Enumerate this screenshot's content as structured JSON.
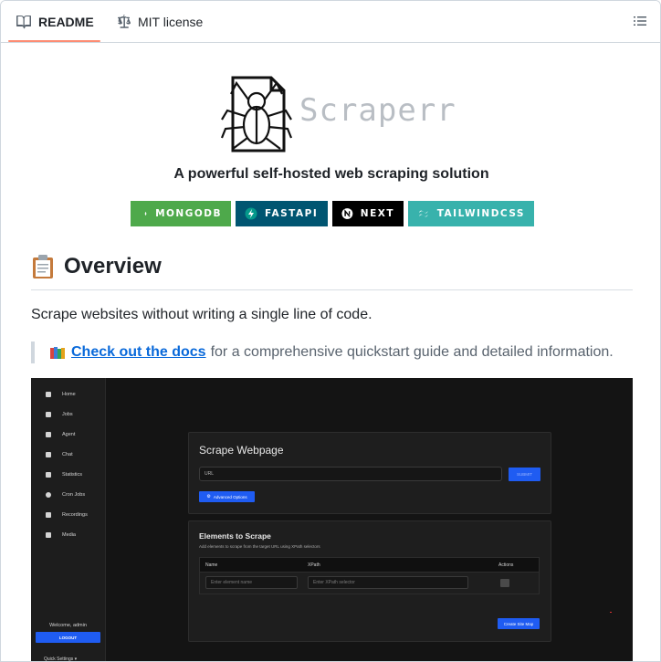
{
  "tabs": [
    {
      "label": "README",
      "icon": "book-icon",
      "active": true
    },
    {
      "label": "MIT license",
      "icon": "scale-icon",
      "active": false
    }
  ],
  "toc_icon": "list-icon",
  "readme": {
    "logo_text": "Scraperr",
    "tagline": "A powerful self-hosted web scraping solution",
    "badges": [
      {
        "label": "MONGODB",
        "color": "#4ea94b",
        "icon": "mongodb-leaf-icon"
      },
      {
        "label": "FASTAPI",
        "color": "#005571",
        "icon": "fastapi-bolt-icon"
      },
      {
        "label": "NEXT",
        "color": "#000000",
        "icon": "nextjs-icon"
      },
      {
        "label": "TAILWINDCSS",
        "color": "#38b2ac",
        "icon": "tailwind-icon"
      }
    ],
    "overview_heading": "Overview",
    "overview_emoji": "clipboard-emoji",
    "intro": "Scrape websites without writing a single line of code.",
    "quote_link": "Check out the docs",
    "quote_rest": "for a comprehensive quickstart guide and detailed information.",
    "quote_emoji": "books-emoji"
  },
  "app_screenshot": {
    "nav": [
      "Home",
      "Jobs",
      "Agent",
      "Chat",
      "Statistics",
      "Cron Jobs",
      "Recordings",
      "Media"
    ],
    "welcome": "Welcome, admin",
    "logout": "LOGOUT",
    "quick_settings": "Quick Settings",
    "scrape_title": "Scrape Webpage",
    "url_placeholder": "URL",
    "submit": "SUBMIT",
    "advanced": "Advanced Options",
    "elements_title": "Elements to Scrape",
    "elements_sub": "Add elements to scrape from the target URL using XPath selectors",
    "columns": [
      "Name",
      "XPath",
      "Actions"
    ],
    "name_placeholder": "Enter element name",
    "xpath_placeholder": "Enter XPath selector",
    "site_map": "Create Site Map"
  }
}
